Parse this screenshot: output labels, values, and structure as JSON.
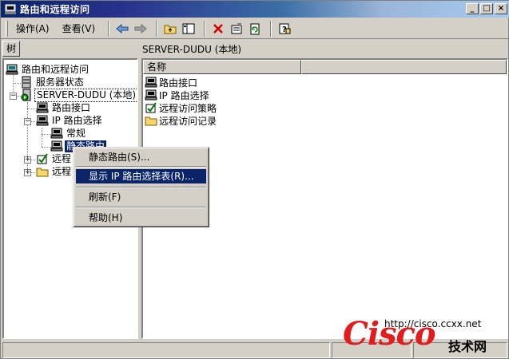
{
  "window": {
    "title": "路由和远程访问",
    "buttons": {
      "minimize": "_",
      "maximize": "□",
      "close": "×"
    }
  },
  "toolbar": {
    "menu": [
      "操作(A)",
      "查看(V)"
    ],
    "icons": [
      "back-arrow-icon",
      "forward-arrow-icon",
      "up-folder-icon",
      "show-tree-icon",
      "delete-icon",
      "properties-icon",
      "refresh-icon",
      "help-icon"
    ]
  },
  "tree_tab": "树",
  "right_title": "SERVER-DUDU (本地)",
  "tree": {
    "items": [
      {
        "label": "路由和远程访问"
      },
      {
        "label": "服务器状态"
      },
      {
        "label": "SERVER-DUDU (本地)"
      },
      {
        "label": "路由接口"
      },
      {
        "label": "IP 路由选择"
      },
      {
        "label": "常规"
      },
      {
        "label": "静态路由"
      },
      {
        "label": "远程"
      },
      {
        "label": "远程"
      }
    ]
  },
  "list": {
    "columns": [
      "名称",
      ""
    ],
    "rows": [
      "路由接口",
      "IP 路由选择",
      "远程访问策略",
      "远程访问记录"
    ]
  },
  "context_menu": {
    "items": [
      "静态路由(S)...",
      "显示 IP 路由选择表(R)...",
      "刷新(F)",
      "帮助(H)"
    ]
  },
  "watermark": {
    "url": "http://cisco.ccxx.net",
    "logo": "Cisco",
    "tag": "技术网"
  },
  "colors": {
    "selection": "#0a246a",
    "logo_red": "#e31b1b"
  }
}
